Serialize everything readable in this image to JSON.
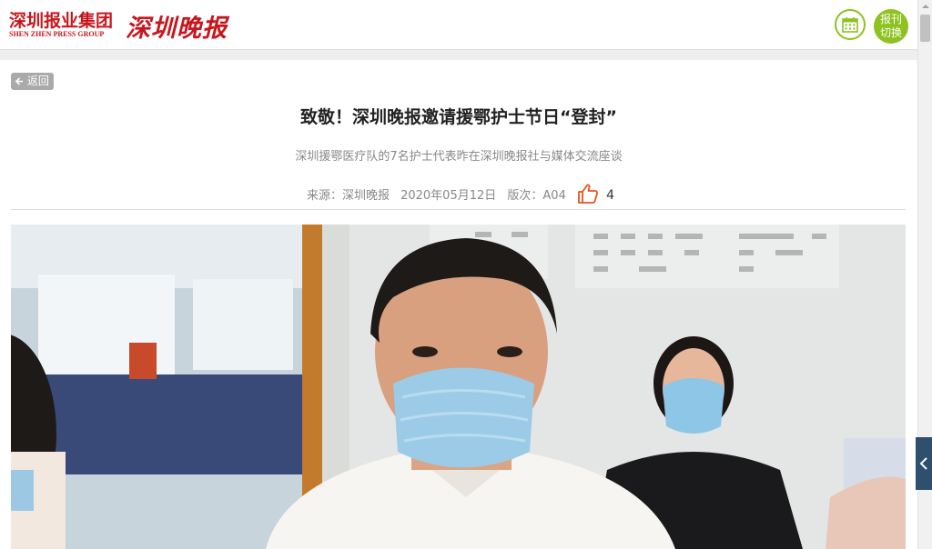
{
  "header": {
    "group_name": "深圳报业集团",
    "group_name_en": "SHEN ZHEN PRESS GROUP",
    "brand_name": "深圳晚报",
    "switch_label": "报刊切换"
  },
  "article": {
    "back_label": "返回",
    "title": "致敬！深圳晚报邀请援鄂护士节日“登封”",
    "subtitle": "深圳援鄂医疗队的7名护士代表昨在深圳晚报社与媒体交流座谈",
    "source": "来源：深圳晚报",
    "date": "2020年05月12日",
    "edition": "版次：A04",
    "like_count": "4"
  },
  "icons": {
    "calendar": "calendar-icon",
    "back": "arrow-left-icon",
    "like": "thumbs-up-icon",
    "side": "chevron-left-icon"
  },
  "colors": {
    "brand_red": "#c8161d",
    "accent_green": "#8dc21f",
    "like_orange": "#e8541e",
    "side_tab": "#2f4f6f"
  }
}
